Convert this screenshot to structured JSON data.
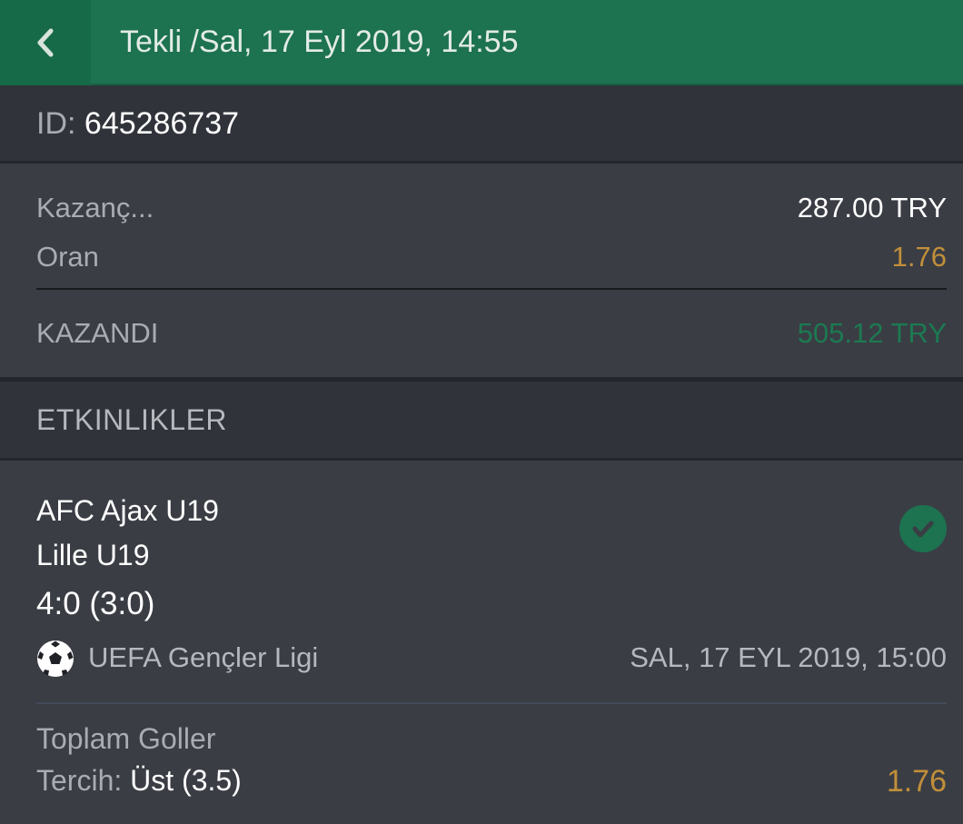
{
  "header": {
    "title": "Tekli /Sal, 17 Eyl 2019, 14:55",
    "back_icon": "chevron-left-icon",
    "colors": {
      "background": "#1d7250",
      "back_background": "#176a48"
    }
  },
  "bet": {
    "id_label": "ID:",
    "id_value": "645286737",
    "stake_label": "Kazanç...",
    "stake_value": "287.00 TRY",
    "odds_label": "Oran",
    "odds_value": "1.76",
    "result_label": "KAZANDI",
    "result_value": "505.12 TRY"
  },
  "events_section": {
    "title": "ETKINLIKLER"
  },
  "event": {
    "home_team": "AFC Ajax U19",
    "away_team": "Lille U19",
    "score": "4:0 (3:0)",
    "status_icon": "check-circle-icon",
    "sport_icon": "soccer-ball-icon",
    "league": "UEFA Gençler Ligi",
    "date": "SAL, 17 EYL 2019, 15:00",
    "market": "Toplam Goller",
    "pick_label": "Tercih:",
    "pick_value": "Üst (3.5)",
    "pick_odds": "1.76"
  },
  "colors": {
    "accent_green": "#1d7250",
    "win_green": "#1c7a52",
    "odds_gold": "#c18f3a",
    "background": "#3a3d44",
    "header_row": "#30333a"
  }
}
